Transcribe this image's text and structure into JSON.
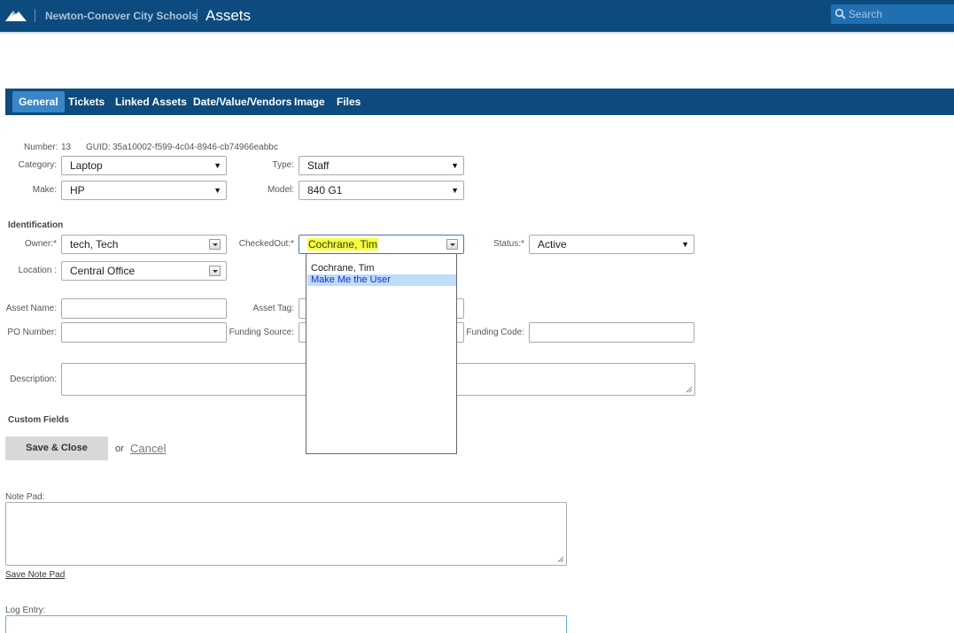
{
  "header": {
    "org_name": "Newton-Conover City Schools",
    "app_title": "Assets",
    "search_placeholder": "Search"
  },
  "tabs": [
    {
      "label": "General",
      "active": true
    },
    {
      "label": "Tickets",
      "active": false
    },
    {
      "label": "Linked Assets",
      "active": false
    },
    {
      "label": "Date/Value/Vendors",
      "active": false
    },
    {
      "label": "Image",
      "active": false
    },
    {
      "label": "Files",
      "active": false
    }
  ],
  "asset": {
    "number_label": "Number:",
    "number_value": "13",
    "guid_label": "GUID:",
    "guid_value": "35a10002-f599-4c04-8946-cb74966eabbc",
    "category_label": "Category:",
    "category_value": "Laptop",
    "type_label": "Type:",
    "type_value": "Staff",
    "make_label": "Make:",
    "make_value": "HP",
    "model_label": "Model:",
    "model_value": "840 G1"
  },
  "identification": {
    "heading": "Identification",
    "owner_label": "Owner:*",
    "owner_value": "tech, Tech",
    "checkedout_label": "CheckedOut:*",
    "checkedout_value": "Cochrane, Tim",
    "status_label": "Status:*",
    "status_value": "Active",
    "location_label": "Location :",
    "location_value": "Central Office",
    "asset_name_label": "Asset Name:",
    "asset_name_value": "",
    "asset_tag_label": "Asset Tag:",
    "asset_tag_value": "",
    "po_number_label": "PO Number:",
    "po_number_value": "",
    "funding_source_label": "Funding Source:",
    "funding_source_value": "",
    "funding_code_label": "Funding Code:",
    "funding_code_value": "",
    "description_label": "Description:",
    "description_value": ""
  },
  "checkedout_dropdown": {
    "options": [
      {
        "label": "Cochrane, Tim",
        "highlighted": false
      },
      {
        "label": "Make Me the User",
        "highlighted": true
      }
    ]
  },
  "custom_fields": {
    "heading": "Custom Fields"
  },
  "actions": {
    "save_close_label": "Save & Close",
    "or_text": "or",
    "cancel_label": "Cancel"
  },
  "notes": {
    "note_pad_label": "Note Pad:",
    "note_pad_value": "",
    "save_note_pad_label": "Save Note Pad",
    "log_entry_label": "Log Entry:",
    "log_entry_value": ""
  },
  "colors": {
    "header_bg": "#0d4b7e",
    "active_tab": "#3a85c6",
    "search_bg": "#1f6fb1",
    "highlight": "#f5ff3a",
    "dropdown_selected": "#bfdcfb"
  }
}
